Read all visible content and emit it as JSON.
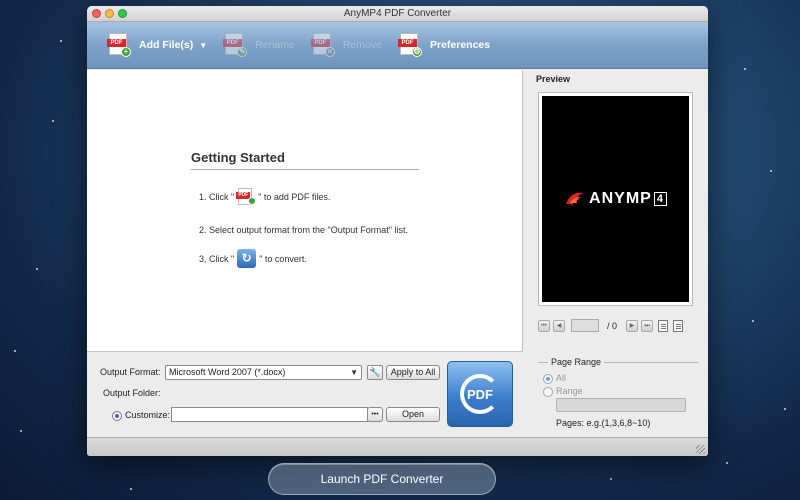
{
  "window": {
    "title": "AnyMP4 PDF Converter"
  },
  "toolbar": {
    "add_files": "Add File(s)",
    "rename": "Rename",
    "remove": "Remove",
    "preferences": "Preferences",
    "pdf_tag": "PDF"
  },
  "getting_started": {
    "title": "Getting Started",
    "step1_pre": "1. Click \"",
    "step1_post": "\" to add PDF files.",
    "step2": "2. Select output format from the \"Output Format\" list.",
    "step3_pre": "3. Click \"",
    "step3_post": "\" to convert."
  },
  "output": {
    "format_label": "Output Format:",
    "format_value": "Microsoft Word 2007 (*.docx)",
    "apply_all": "Apply to All",
    "folder_label": "Output Folder:",
    "customize_label": "Customize:",
    "browse": "•••",
    "open": "Open",
    "convert_label": "PDF"
  },
  "preview": {
    "title": "Preview",
    "logo_text": "ANYMP",
    "logo_num": "4",
    "page_total": "/ 0"
  },
  "page_range": {
    "title": "Page Range",
    "all": "All",
    "range": "Range",
    "hint": "Pages: e.g.(1,3,6,8~10)"
  },
  "launch_button": "Launch PDF Converter",
  "colors": {
    "toolbar": "#7fa2c9",
    "pdf_red": "#d8262a",
    "convert_blue": "#3d7fcc"
  }
}
